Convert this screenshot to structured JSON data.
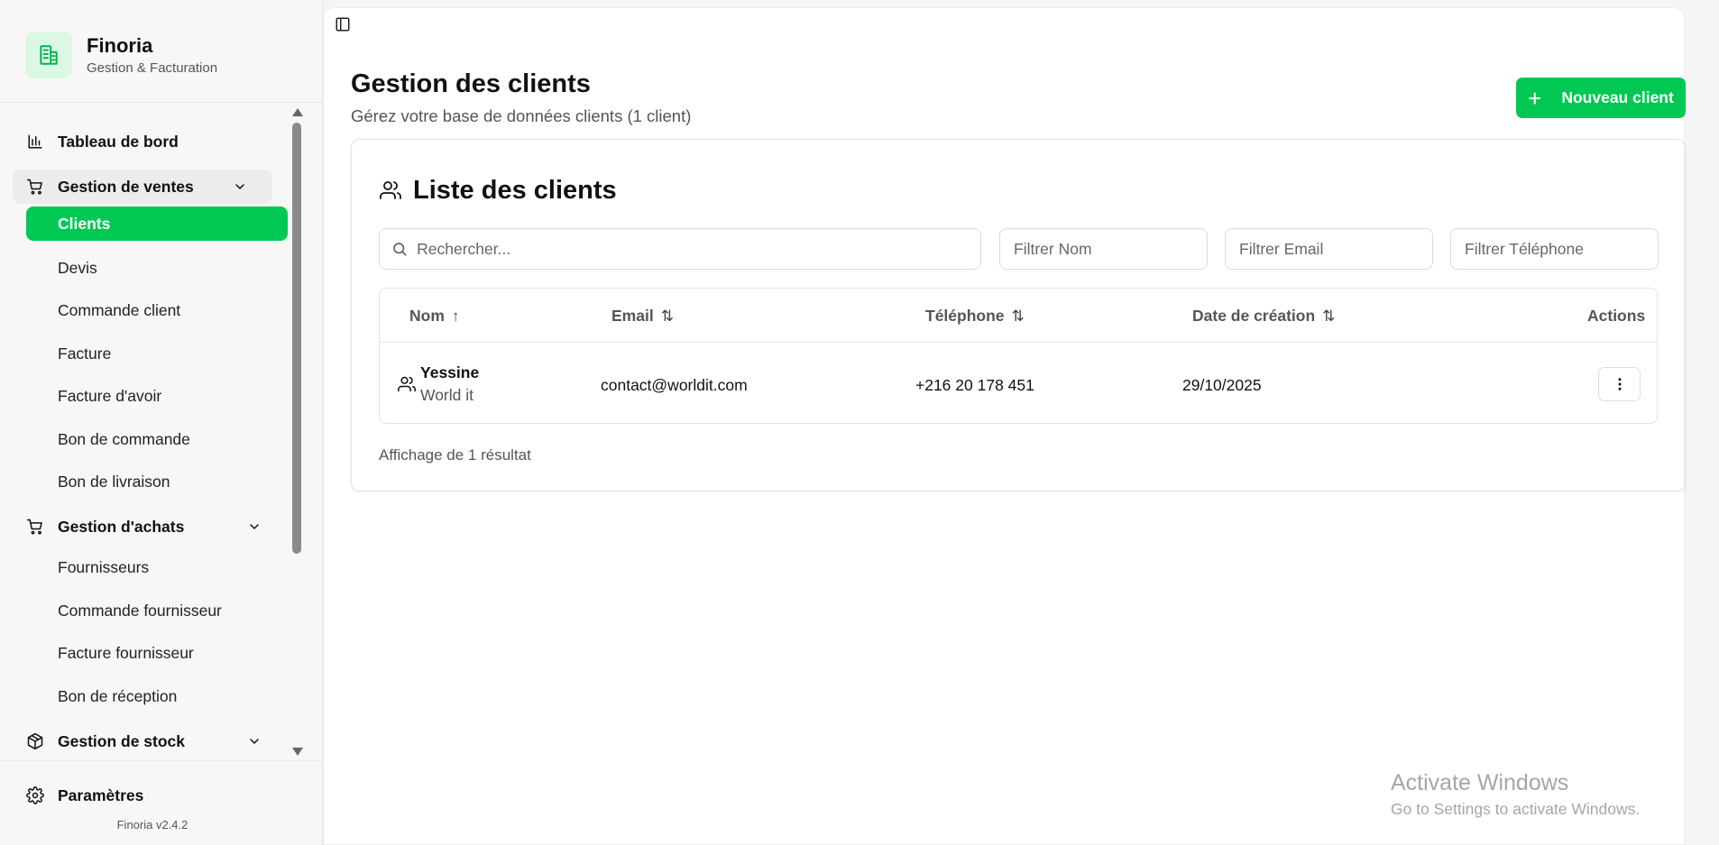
{
  "brand": {
    "name": "Finoria",
    "subtitle": "Gestion & Facturation"
  },
  "sidebar": {
    "dashboard": "Tableau de bord",
    "sales_group": "Gestion de ventes",
    "sales_items": [
      "Clients",
      "Devis",
      "Commande client",
      "Facture",
      "Facture d'avoir",
      "Bon de commande",
      "Bon de livraison"
    ],
    "purchases_group": "Gestion d'achats",
    "purchases_items": [
      "Fournisseurs",
      "Commande fournisseur",
      "Facture fournisseur",
      "Bon de réception"
    ],
    "stock_group": "Gestion de stock",
    "settings": "Paramètres",
    "version": "Finoria v2.4.2"
  },
  "header": {
    "title": "Gestion des clients",
    "subtitle": "Gérez votre base de données clients (1 client)",
    "new_button": "Nouveau client"
  },
  "card": {
    "title": "Liste des clients",
    "search_placeholder": "Rechercher...",
    "filters": [
      "Filtrer Nom",
      "Filtrer Email",
      "Filtrer Téléphone"
    ]
  },
  "table": {
    "columns": [
      "Nom",
      "Email",
      "Téléphone",
      "Date de création",
      "Actions"
    ],
    "sort_icons": {
      "asc": "↑",
      "both": "⇅"
    },
    "rows": [
      {
        "name": "Yessine",
        "company": "World it",
        "email": "contact@worldit.com",
        "phone": "+216 20 178 451",
        "created": "29/10/2025"
      }
    ]
  },
  "result_count": "Affichage de 1 résultat",
  "watermark": {
    "title": "Activate Windows",
    "subtitle": "Go to Settings to activate Windows."
  },
  "colors": {
    "accent": "#00c853",
    "accent_light": "#dcf7e6"
  }
}
